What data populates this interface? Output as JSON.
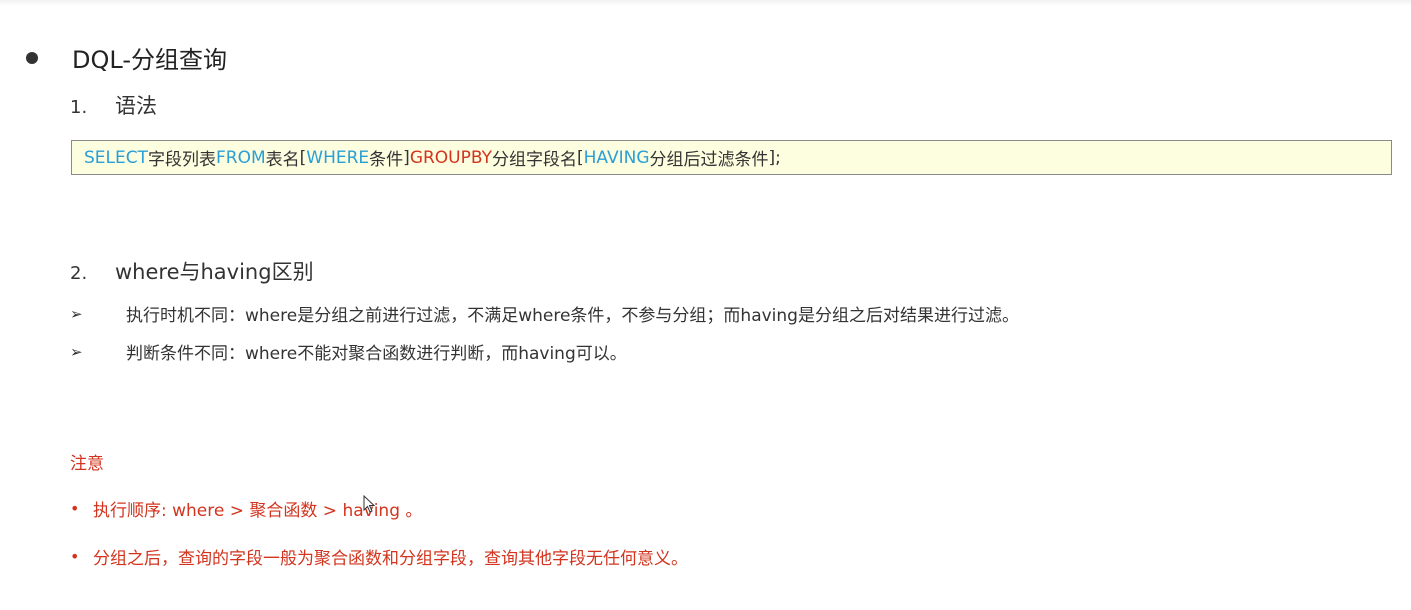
{
  "title": "DQL-分组查询",
  "section1": {
    "number": "1.",
    "heading": "语法"
  },
  "syntax": {
    "kw_select": "SELECT",
    "field_list": "字段列表",
    "kw_from": "FROM",
    "table_name": "表名",
    "bracket_open_1": "[",
    "kw_where": "WHERE",
    "condition": "条件",
    "bracket_close_1": "]",
    "kw_group": "GROUP",
    "kw_by": "BY",
    "group_field": "分组字段名",
    "bracket_open_2": "[",
    "kw_having": "HAVING",
    "having_condition": "分组后过滤条件",
    "bracket_close_2": "];"
  },
  "section2": {
    "number": "2.",
    "heading": "where与having区别"
  },
  "differences": [
    {
      "bullet": "➢",
      "text": "执行时机不同：where是分组之前进行过滤，不满足where条件，不参与分组；而having是分组之后对结果进行过滤。"
    },
    {
      "bullet": "➢",
      "text": "判断条件不同：where不能对聚合函数进行判断，而having可以。"
    }
  ],
  "note": {
    "title": "注意",
    "items": [
      {
        "bullet": "•",
        "text": "执行顺序: where  >  聚合函数 > having 。"
      },
      {
        "bullet": "•",
        "text": "分组之后，查询的字段一般为聚合函数和分组字段，查询其他字段无任何意义。"
      }
    ]
  },
  "colors": {
    "keyword_blue": "#2a9fd6",
    "keyword_red": "#d2341e",
    "note_red": "#d2341e",
    "syntax_bg": "#fdfde0"
  },
  "icons": {
    "title_bullet": "filled-circle-bullet",
    "diff_bullet": "arrowhead-bullet",
    "note_bullet": "dot-bullet",
    "cursor": "mouse-pointer-icon"
  }
}
